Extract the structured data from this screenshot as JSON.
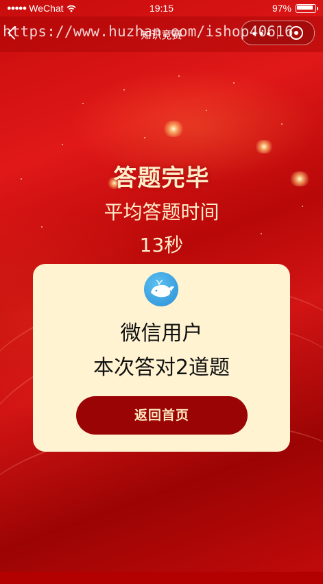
{
  "status_bar": {
    "carrier": "WeChat",
    "time": "19:15",
    "battery": "97%"
  },
  "nav": {
    "title": "知识竞赛"
  },
  "watermark": "https://www.huzhan.com/ishop40616",
  "result": {
    "title": "答题完毕",
    "avg_label": "平均答题时间",
    "avg_value": "13秒"
  },
  "card": {
    "user_name": "微信用户",
    "score_text": "本次答对2道题",
    "home_button": "返回首页"
  },
  "colors": {
    "background": "#c80c0c",
    "card": "#fff3d2",
    "button": "#9b0404",
    "heading_text": "#ffeeca"
  },
  "icons": {
    "back": "back-arrow-icon",
    "menu": "more-dots-icon",
    "close": "close-circle-icon",
    "avatar": "whale-avatar-icon"
  }
}
